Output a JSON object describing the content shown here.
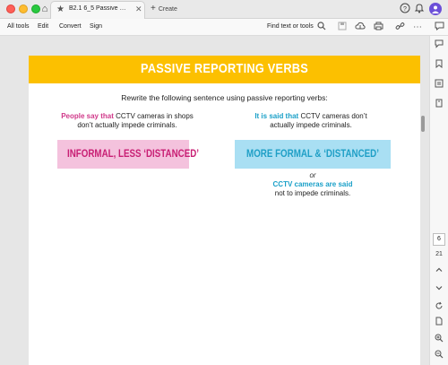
{
  "tabbar": {
    "tab_title": "B2.1 6_5 Passive Repor...",
    "tab_star_icon": "★",
    "tab_close_icon": "✕",
    "create_label": "Create",
    "create_icon": "+",
    "home_icon": "⌂"
  },
  "toolbar": {
    "menu": [
      "All tools",
      "Edit",
      "Convert",
      "Sign"
    ],
    "find_label": "Find text or tools"
  },
  "document": {
    "banner_title": "PASSIVE REPORTING VERBS",
    "instruction": "Rewrite the following sentence using passive reporting verbs:",
    "left": {
      "highlight": "People say that",
      "rest_line1": " CCTV cameras in shops",
      "line2": "don’t actually impede criminals.",
      "box_label": "INFORMAL, LESS ‘DISTANCED’"
    },
    "right": {
      "highlight": "It is said that",
      "rest_line1": " CCTV cameras don’t",
      "line2": "actually impede criminals.",
      "box_label": "MORE FORMAL & ‘DISTANCED’",
      "or_text": "or",
      "alt_highlight": "CCTV cameras are said",
      "alt_line2": "not to impede criminals."
    }
  },
  "rail": {
    "current_page": "6",
    "total_pages": "21"
  },
  "colors": {
    "banner": "#fcc000",
    "pink_text": "#d0398a",
    "pink_box": "#f4c2dd",
    "teal_text": "#1aa0c8",
    "teal_box": "#a9dff3"
  }
}
